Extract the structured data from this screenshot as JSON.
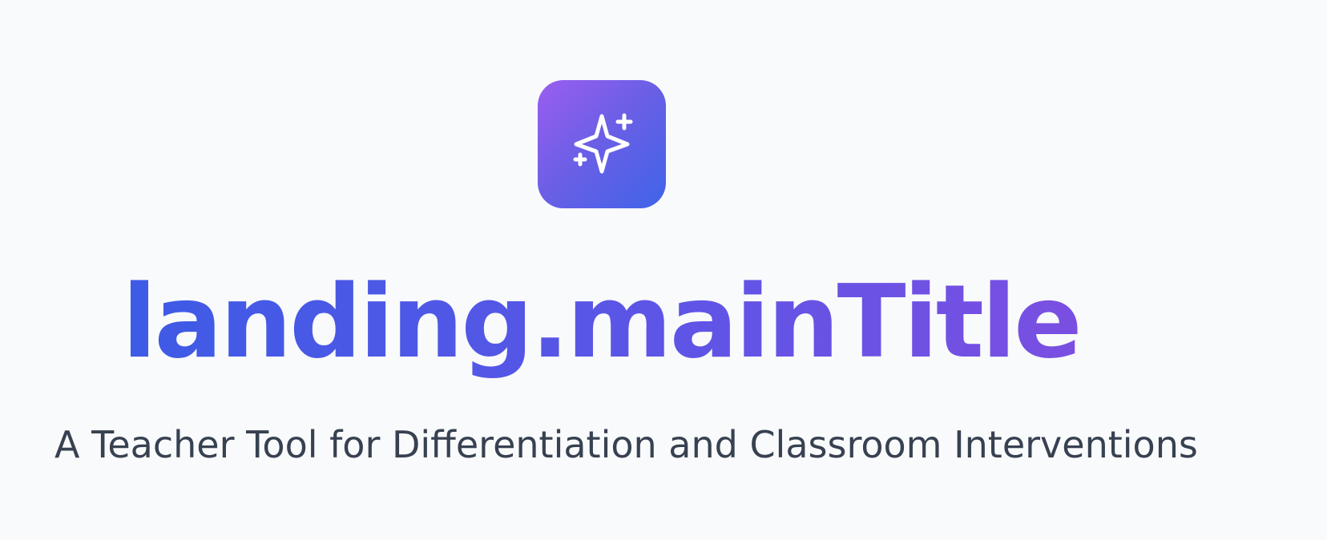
{
  "hero": {
    "logo_icon": "sparkles-icon",
    "main_title": "landing.mainTitle",
    "subtitle": "A Teacher Tool for Differentiation and Classroom Interventions"
  },
  "colors": {
    "background": "#f9fafb",
    "logo_gradient_start": "#9b5ef0",
    "logo_gradient_end": "#3f64e8",
    "title_gradient_start": "#3d5be6",
    "title_gradient_end": "#7a4fe2",
    "subtitle_text": "#374151"
  }
}
